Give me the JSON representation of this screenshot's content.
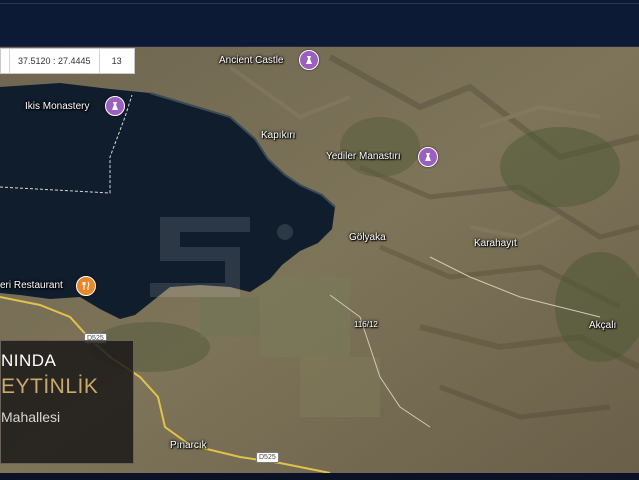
{
  "coords": {
    "latlng": "37.5120 : 27.4445",
    "zoom": "13"
  },
  "places": [
    {
      "key": "ancient-castle",
      "text": "Ancient Castle"
    },
    {
      "key": "ikis-monastery",
      "text": "Ikis Monastery"
    },
    {
      "key": "kapikiri",
      "text": "Kapıkırı"
    },
    {
      "key": "yediler-manastiri",
      "text": "Yediler Manastırı"
    },
    {
      "key": "golyaka",
      "text": "Gölyaka"
    },
    {
      "key": "karahayit",
      "text": "Karahayıt"
    },
    {
      "key": "restaurant",
      "text": "eri Restaurant"
    },
    {
      "key": "akcali",
      "text": "Akçalı"
    },
    {
      "key": "pinarcik",
      "text": "Pınarcık"
    }
  ],
  "roads": {
    "d525_north": "D525",
    "d525_south": "D525",
    "local_road": "116/12"
  },
  "panel": {
    "line1": "NINDA",
    "line2": "EYTİNLİK",
    "line3": "Mahallesi"
  },
  "icons": {
    "poi_monument": "monument-icon",
    "poi_food": "restaurant-icon"
  },
  "colors": {
    "poi_monument": "#9b5fc0",
    "poi_food": "#e8862a",
    "road": "#e3c24a",
    "water": "#0f1d2c"
  }
}
